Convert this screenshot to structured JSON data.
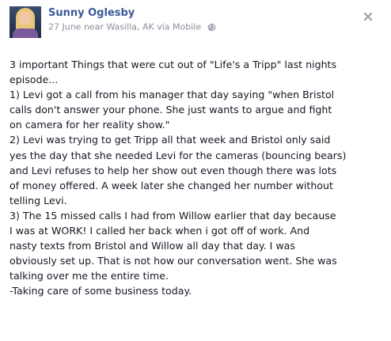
{
  "post": {
    "author": "Sunny Oglesby",
    "date": "27 June near Wasilla, AK via Mobile",
    "avatar_icon": "profile-photo",
    "privacy_icon": "globe-icon",
    "close_icon": "close-icon",
    "text_lines": [
      "3 important Things that were cut out of \"Life's a Tripp\" last nights",
      "episode...",
      "1) Levi got a call from his manager that day saying \"when Bristol",
      "calls don't answer your phone. She just wants to argue and fight",
      "on camera for her reality show.\"",
      "2) Levi was trying to get Tripp all that week and Bristol only said",
      "yes the day that she needed Levi for the cameras (bouncing bears)",
      "and Levi refuses to help her show out even though there was lots",
      "of money offered. A week later she changed her number without",
      "telling Levi.",
      "3) The 15 missed calls I had from Willow earlier that day because",
      "I was at WORK! I called her back when i got off of work. And",
      "nasty texts from Bristol and Willow all day that day. I was",
      "obviously set up. That is not how our conversation went. She was",
      "talking over me the entire time.",
      "-Taking care of some business today."
    ]
  },
  "colors": {
    "author_link": "#3b5998",
    "meta_gray": "#8a8f9a",
    "body_text": "#141823"
  }
}
